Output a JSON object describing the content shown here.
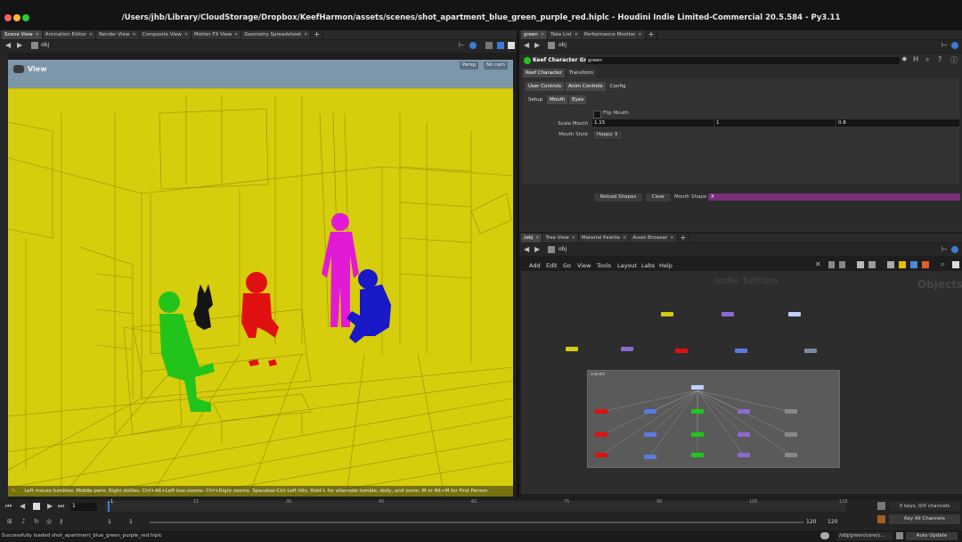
{
  "window": {
    "title": "/Users/jhb/Library/CloudStorage/Dropbox/KeefHarmon/assets/scenes/shot_apartment_blue_green_purple_red.hiplc - Houdini Indie Limited-Commercial 20.5.584 - Py3.11"
  },
  "left_tabs": [
    "Scene View",
    "Animation Editor",
    "Render View",
    "Composite View",
    "Motion FX View",
    "Geometry Spreadsheet"
  ],
  "left_path": "obj",
  "viewport": {
    "label": "View",
    "persp": "Persp",
    "cam": "No cam",
    "help_text": "Left mouse tumbles. Middle pans. Right dollies. Ctrl+Alt+Left box-zooms. Ctrl+Right zooms. Spacebar-Ctrl-Left tilts. Hold L for alternate tumble, dolly, and zoom. M or Alt+M for First Person Navigation."
  },
  "right_top_tabs": [
    "green",
    "Take List",
    "Performance Monitor"
  ],
  "right_top_path": "obj",
  "params": {
    "node_type": "Keef Character Green",
    "node_name": "green",
    "main_tabs": [
      "Keef Character",
      "Transform"
    ],
    "sub_tabs": [
      "User Controls",
      "Anim Controls",
      "Config"
    ],
    "section_tabs": [
      "Setup",
      "Mouth",
      "Eyes"
    ],
    "flip_mouth_label": "Flip Mouth",
    "scale_mouth_label": "Scale Mouth",
    "scale_mouth_values": [
      "1.15",
      "1",
      "0.8"
    ],
    "mouth_style_label": "Mouth Style",
    "mouth_style_value": "Happy",
    "reload_label": "Reload Shapes",
    "clear_label": "Clear",
    "mouth_shape_label": "Mouth Shape",
    "mouth_shape_value": "X"
  },
  "net_tabs": [
    "/obj",
    "Tree View",
    "Material Palette",
    "Asset Browser"
  ],
  "net_path": "obj",
  "net_menu": [
    "Add",
    "Edit",
    "Go",
    "View",
    "Tools",
    "Layout",
    "Labs",
    "Help"
  ],
  "network": {
    "watermark": "Indie Edition",
    "context": "Objects",
    "box_title": "subnet1"
  },
  "timeline": {
    "frame": "1",
    "ticks": [
      "1",
      "15",
      "30",
      "45",
      "60",
      "75",
      "90",
      "105",
      "120"
    ],
    "start": "1",
    "start2": "1",
    "end": "120",
    "end2": "120",
    "keys": "0 keys, 0/0 channels",
    "key_all": "Key All Channels"
  },
  "status": {
    "message": "Successfully loaded shot_apartment_blue_green_purple_red.hiplc",
    "path": "/obj/green/core/c...",
    "update": "Auto Update"
  },
  "colors": {
    "viewport_bg": "#d6cd0c",
    "green": "#22c41c",
    "red": "#e01010",
    "magenta": "#e21ad6",
    "blue": "#1818c8"
  }
}
